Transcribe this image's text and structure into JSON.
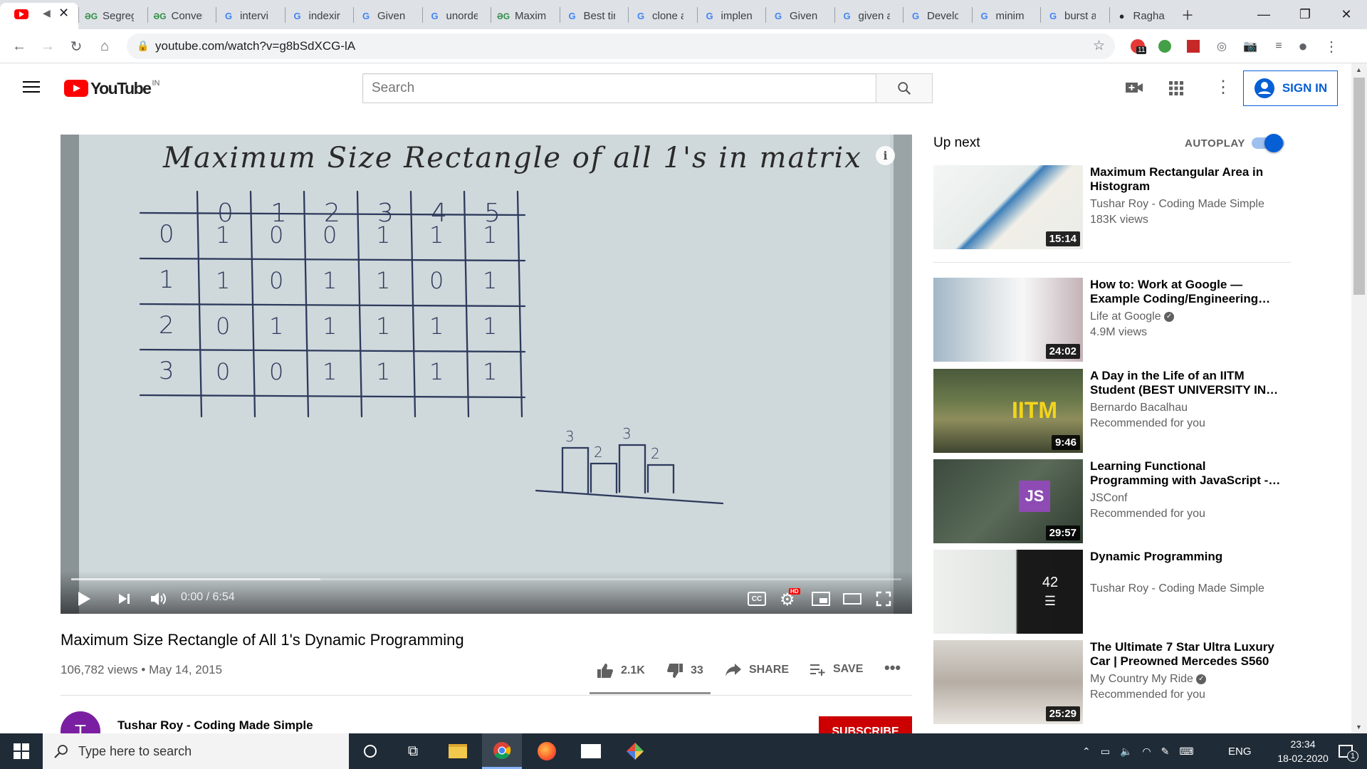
{
  "tabs": [
    {
      "label": "",
      "fav": "yt"
    },
    {
      "label": "Segreg",
      "fav": "gfg"
    },
    {
      "label": "Conver",
      "fav": "gfg"
    },
    {
      "label": "intervi",
      "fav": "g"
    },
    {
      "label": "indexir",
      "fav": "g"
    },
    {
      "label": "Given a",
      "fav": "g"
    },
    {
      "label": "unorde",
      "fav": "g"
    },
    {
      "label": "Maxim",
      "fav": "gfg"
    },
    {
      "label": "Best tir",
      "fav": "g"
    },
    {
      "label": "clone a",
      "fav": "g"
    },
    {
      "label": "implen",
      "fav": "g"
    },
    {
      "label": "Given a",
      "fav": "g"
    },
    {
      "label": "given a",
      "fav": "g"
    },
    {
      "label": "Develo",
      "fav": "g"
    },
    {
      "label": "minim",
      "fav": "g"
    },
    {
      "label": "burst a",
      "fav": "g"
    },
    {
      "label": "Ragha",
      "fav": "gh"
    }
  ],
  "browser": {
    "url": "youtube.com/watch?v=g8bSdXCG-lA",
    "ext_badge": "11"
  },
  "youtube": {
    "logo_text": "YouTube",
    "region": "IN",
    "search_placeholder": "Search",
    "signin_label": "SIGN IN"
  },
  "video": {
    "board_title": "Maximum Size Rectangle of all 1's in matrix",
    "col_headers": [
      "0",
      "1",
      "2",
      "3",
      "4",
      "5"
    ],
    "row_headers": [
      "0",
      "1",
      "2",
      "3"
    ],
    "matrix": [
      [
        "1",
        "0",
        "0",
        "1",
        "1",
        "1"
      ],
      [
        "1",
        "0",
        "1",
        "1",
        "0",
        "1"
      ],
      [
        "0",
        "1",
        "1",
        "1",
        "1",
        "1"
      ],
      [
        "0",
        "0",
        "1",
        "1",
        "1",
        "1"
      ]
    ],
    "histogram_labels": [
      "3",
      "2",
      "3",
      "2"
    ],
    "time_text": "0:00 / 6:54",
    "progress_fraction": 0,
    "buffered_fraction": 0.3,
    "hd_badge": "HD",
    "cc_label": "CC",
    "title": "Maximum Size Rectangle of All 1's Dynamic Programming",
    "meta": "106,782 views • May 14, 2015",
    "likes": "2.1K",
    "dislikes": "33",
    "share_label": "SHARE",
    "save_label": "SAVE",
    "channel": "Tushar Roy - Coding Made Simple",
    "channel_initial": "T",
    "subscribe_label": "SUBSCRIBE"
  },
  "sidebar": {
    "up_next_label": "Up next",
    "autoplay_label": "AUTOPLAY",
    "autoplay_on": true,
    "items": [
      {
        "title": "Maximum Rectangular Area in Histogram",
        "channel": "Tushar Roy - Coding Made Simple",
        "views": "183K views",
        "duration": "15:14",
        "verified": false
      },
      {
        "title": "How to: Work at Google — Example Coding/Engineering Interview",
        "channel": "Life at Google",
        "views": "4.9M views",
        "duration": "24:02",
        "verified": true
      },
      {
        "title": "A Day in the Life of an IITM Student (BEST UNIVERSITY IN INDIA)",
        "channel": "Bernardo Bacalhau",
        "views": "Recommended for you",
        "duration": "9:46",
        "verified": false,
        "thumb_text": "IITM"
      },
      {
        "title": "Learning Functional Programming with JavaScript - Anjana Vakil",
        "channel": "JSConf",
        "views": "Recommended for you",
        "duration": "29:57",
        "verified": false,
        "thumb_text": "JS"
      },
      {
        "title": "Dynamic Programming",
        "channel": "Tushar Roy - Coding Made Simple",
        "views": "",
        "duration": "",
        "verified": false,
        "playlist_count": "42"
      },
      {
        "title": "The Ultimate 7 Star Ultra Luxury Car | Preowned Mercedes S560",
        "channel": "My Country My Ride",
        "views": "Recommended for you",
        "duration": "25:29",
        "verified": true
      }
    ]
  },
  "taskbar": {
    "search_placeholder": "Type here to search",
    "lang": "ENG",
    "time": "23:34",
    "date": "18-02-2020",
    "notif_count": "1"
  }
}
